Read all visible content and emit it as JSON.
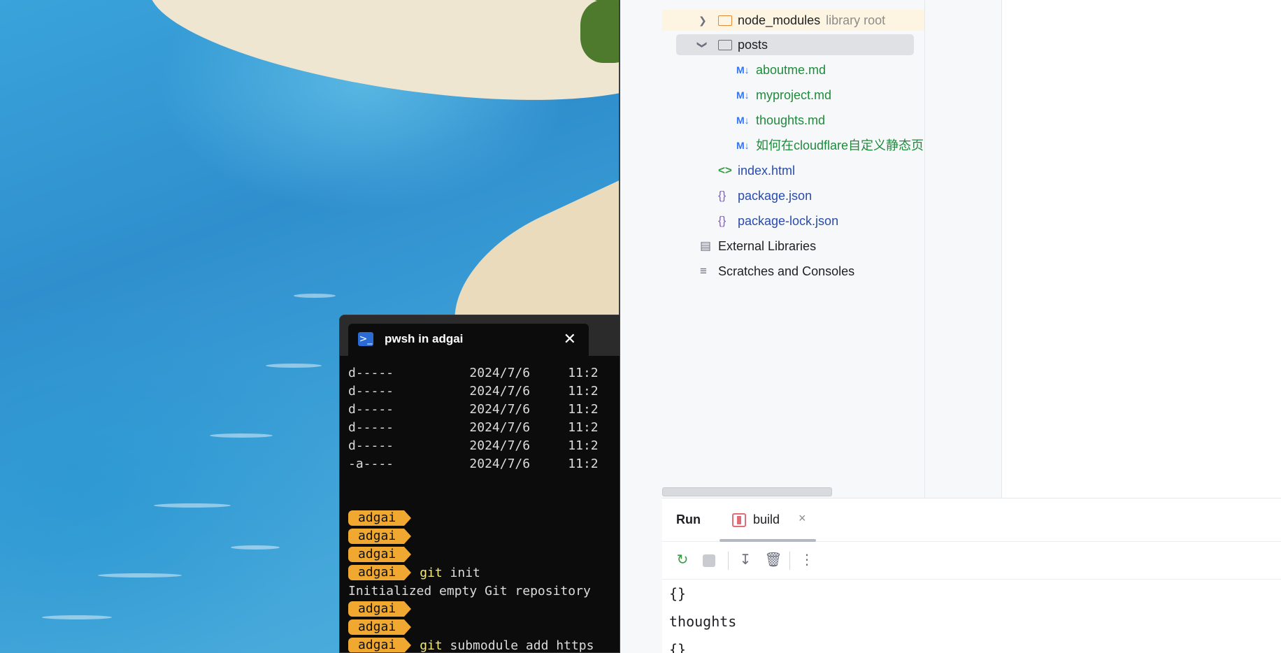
{
  "terminal": {
    "tab_title": "pwsh in adgai",
    "close_glyph": "✕",
    "ps_glyph": ">_",
    "listing": [
      {
        "mode": "d-----",
        "date": "2024/7/6",
        "time": "11:2"
      },
      {
        "mode": "d-----",
        "date": "2024/7/6",
        "time": "11:2"
      },
      {
        "mode": "d-----",
        "date": "2024/7/6",
        "time": "11:2"
      },
      {
        "mode": "d-----",
        "date": "2024/7/6",
        "time": "11:2"
      },
      {
        "mode": "d-----",
        "date": "2024/7/6",
        "time": "11:2"
      },
      {
        "mode": "-a----",
        "date": "2024/7/6",
        "time": "11:2"
      }
    ],
    "prompt_label": "adgai",
    "cmd_git": "git",
    "cmd_init_arg": "init",
    "output_init": "Initialized empty Git repository",
    "cmd_submodule_args": "submodule add https"
  },
  "project_tree": {
    "node_modules": {
      "label": "node_modules",
      "hint": "library root"
    },
    "posts": {
      "label": "posts"
    },
    "files_md": [
      {
        "label": "aboutme.md"
      },
      {
        "label": "myproject.md"
      },
      {
        "label": "thoughts.md"
      },
      {
        "label": "如何在cloudflare自定义静态页"
      }
    ],
    "md_glyph": "M↓",
    "index_html": "index.html",
    "package_json": "package.json",
    "package_lock": "package-lock.json",
    "external_libraries": "External Libraries",
    "scratches": "Scratches and Consoles"
  },
  "run_panel": {
    "title": "Run",
    "tab_label": "build",
    "tab_close": "×",
    "console_lines": [
      "{}",
      "thoughts",
      "{}"
    ]
  }
}
